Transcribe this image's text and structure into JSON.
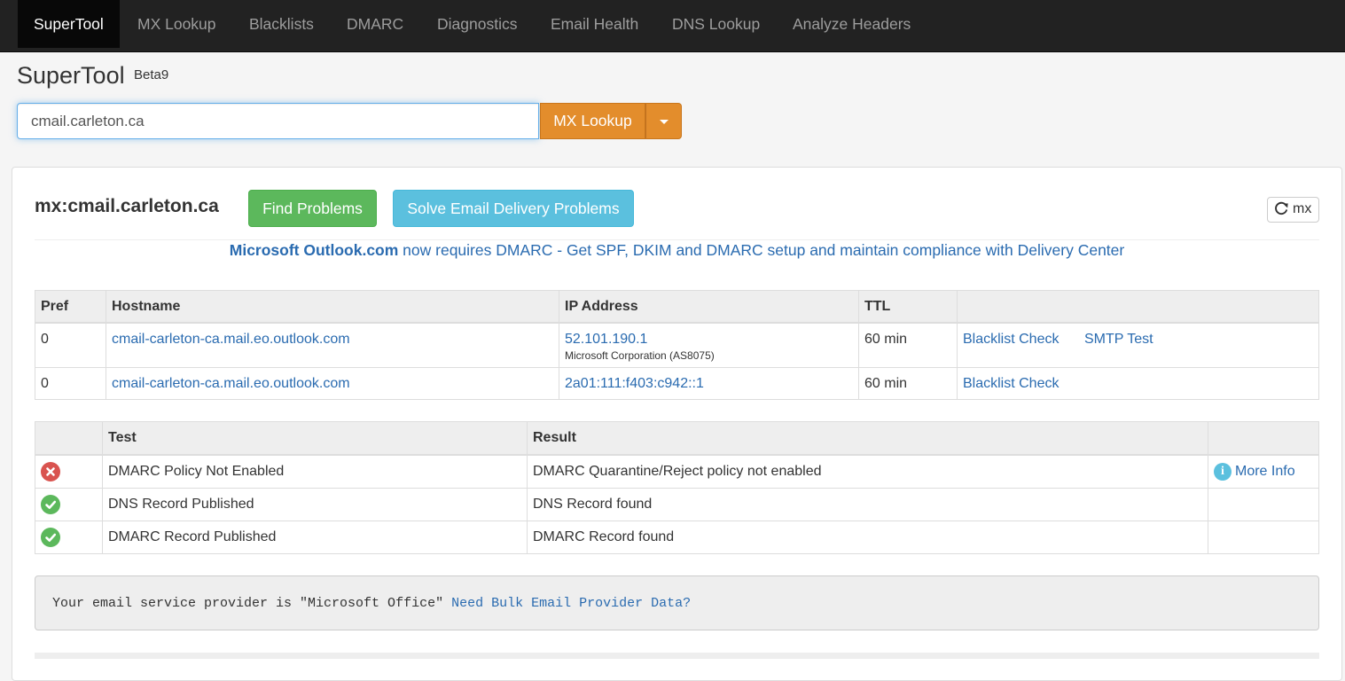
{
  "nav": {
    "items": [
      "SuperTool",
      "MX Lookup",
      "Blacklists",
      "DMARC",
      "Diagnostics",
      "Email Health",
      "DNS Lookup",
      "Analyze Headers"
    ]
  },
  "header": {
    "brand": "SuperTool",
    "version": "Beta9"
  },
  "search": {
    "value": "cmail.carleton.ca",
    "button_label": "MX Lookup"
  },
  "result": {
    "title": "mx:cmail.carleton.ca",
    "find_button": "Find Problems",
    "solve_button": "Solve Email Delivery Problems",
    "refresh_label": "mx",
    "promo_bold": "Microsoft Outlook.com",
    "promo_rest": " now requires DMARC - Get SPF, DKIM and DMARC setup and maintain compliance with Delivery Center"
  },
  "mx_table": {
    "headers": [
      "Pref",
      "Hostname",
      "IP Address",
      "TTL",
      ""
    ],
    "rows": [
      {
        "pref": "0",
        "hostname": "cmail-carleton-ca.mail.eo.outlook.com",
        "ip": "52.101.190.1",
        "ip_owner": "Microsoft Corporation (AS8075)",
        "ttl": "60 min",
        "action1": "Blacklist Check",
        "action2": "SMTP Test"
      },
      {
        "pref": "0",
        "hostname": "cmail-carleton-ca.mail.eo.outlook.com",
        "ip": "2a01:111:f403:c942::1",
        "ip_owner": "",
        "ttl": "60 min",
        "action1": "Blacklist Check",
        "action2": ""
      }
    ]
  },
  "test_table": {
    "headers": [
      "",
      "Test",
      "Result",
      ""
    ],
    "rows": [
      {
        "status": "error",
        "status_icon": "x-circle-icon",
        "test": "DMARC Policy Not Enabled",
        "result": "DMARC Quarantine/Reject policy not enabled",
        "more": "More Info"
      },
      {
        "status": "ok",
        "status_icon": "check-circle-icon",
        "test": "DNS Record Published",
        "result": "DNS Record found",
        "more": ""
      },
      {
        "status": "ok",
        "status_icon": "check-circle-icon",
        "test": "DMARC Record Published",
        "result": "DMARC Record found",
        "more": ""
      }
    ]
  },
  "provider": {
    "text": "Your email service provider is \"Microsoft Office\"",
    "link": "Need Bulk Email Provider Data?"
  },
  "colors": {
    "navbar": "#222222",
    "link": "#2a6bb0",
    "mx_button": "#e38d2c",
    "success": "#5cb85c",
    "info": "#5bc0de",
    "danger": "#d9534f"
  }
}
